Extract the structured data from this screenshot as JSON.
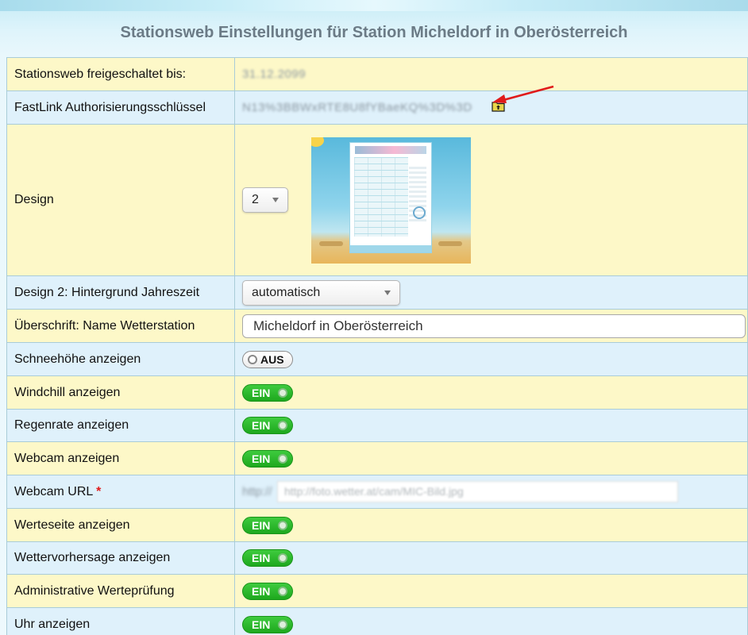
{
  "page": {
    "title": "Stationsweb Einstellungen für Station Micheldorf in Oberösterreich"
  },
  "rows": {
    "unlocked_until": {
      "label": "Stationsweb freigeschaltet bis:",
      "value": "31.12.2099"
    },
    "fastlink": {
      "label": "FastLink Authorisierungsschlüssel",
      "value": "N13%3BBWxRTE8U8fYBaeKQ%3D%3D",
      "icon": "folder-upload-icon"
    },
    "design": {
      "label": "Design",
      "selected": "2"
    },
    "season": {
      "label": "Design 2: Hintergrund Jahreszeit",
      "selected": "automatisch"
    },
    "station_name": {
      "label": "Überschrift: Name Wetterstation",
      "value": "Micheldorf in Oberösterreich"
    },
    "snow_depth": {
      "label": "Schneehöhe anzeigen",
      "state": "AUS"
    },
    "windchill": {
      "label": "Windchill anzeigen",
      "state": "EIN"
    },
    "rain_rate": {
      "label": "Regenrate anzeigen",
      "state": "EIN"
    },
    "webcam": {
      "label": "Webcam anzeigen",
      "state": "EIN"
    },
    "webcam_url": {
      "label": "Webcam URL",
      "required_mark": "*",
      "prefix": "http://",
      "value": "http://foto.wetter.at/cam/MIC-Bild.jpg"
    },
    "value_page": {
      "label": "Werteseite anzeigen",
      "state": "EIN"
    },
    "forecast": {
      "label": "Wettervorhersage anzeigen",
      "state": "EIN"
    },
    "admin_check": {
      "label": "Administrative Werteprüfung",
      "state": "EIN"
    },
    "clock": {
      "label": "Uhr anzeigen",
      "state": "EIN"
    }
  },
  "colors": {
    "row_yellow": "#fdf8c8",
    "row_blue": "#dff1fb",
    "toggle_on": "#2cb92c",
    "annotation_arrow": "#e01b1b"
  }
}
